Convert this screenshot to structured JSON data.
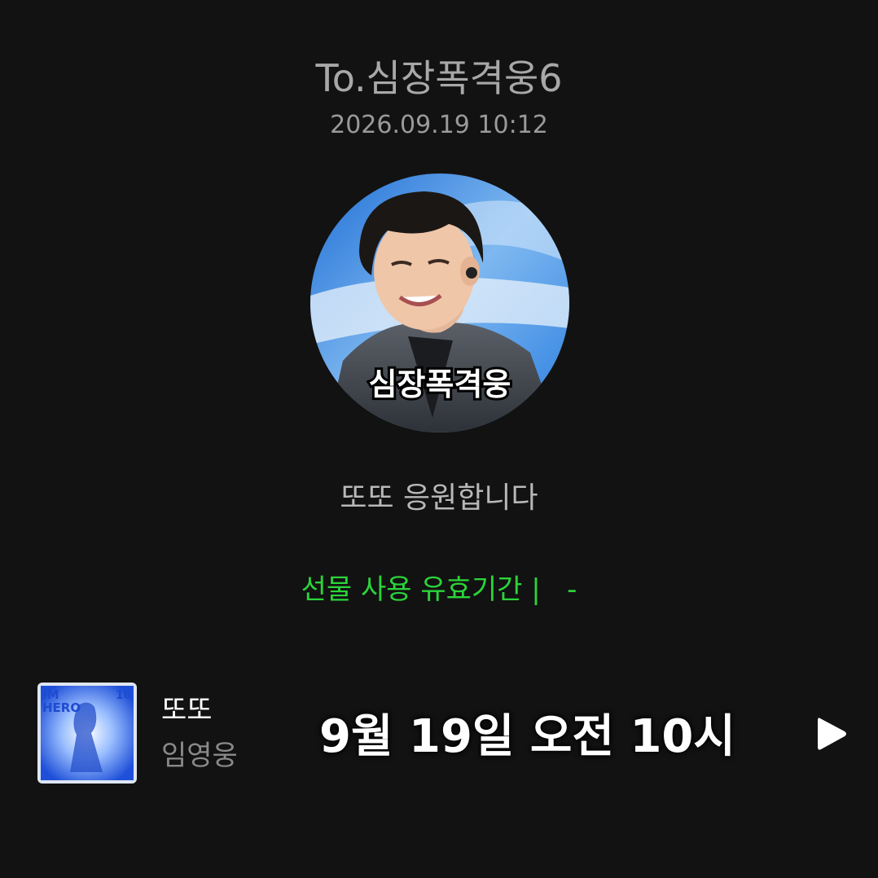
{
  "header": {
    "recipient": "To.심장폭격웅6",
    "timestamp": "2026.09.19 10:12"
  },
  "avatar": {
    "overlay_text": "심장폭격웅"
  },
  "message": {
    "text": "또또 응원합니다"
  },
  "gift": {
    "validity_label": "선물 사용 유효기간 |",
    "validity_value": "-",
    "accent_color": "#2bd439"
  },
  "track": {
    "title": "또또",
    "artist": "임영웅",
    "album_art_text_1": "IM",
    "album_art_text_2": "HERO",
    "album_art_text_3": "10",
    "play_icon": "play-icon"
  },
  "overlay": {
    "caption": "9월 19일 오전 10시"
  }
}
